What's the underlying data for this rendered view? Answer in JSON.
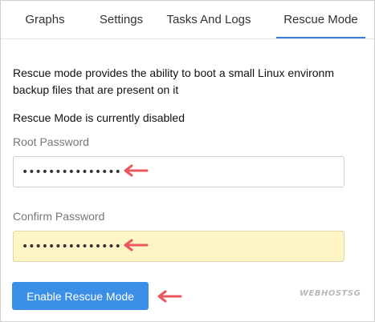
{
  "tabs": [
    {
      "label": "Graphs"
    },
    {
      "label": "Settings"
    },
    {
      "label": "Tasks And Logs"
    },
    {
      "label": "Rescue Mode",
      "active": true
    }
  ],
  "rescue": {
    "description_line1": "Rescue mode provides the ability to boot a small Linux environm",
    "description_line2": "backup files that are present on it",
    "status": "Rescue Mode is currently disabled",
    "root_password_label": "Root Password",
    "root_password_value": "•••••••••••••••",
    "confirm_password_label": "Confirm Password",
    "confirm_password_value": "•••••••••••••••",
    "button_label": "Enable Rescue Mode"
  },
  "watermark": "WEBHOSTSG",
  "colors": {
    "accent": "#3b7ddd",
    "button": "#3b8fe6",
    "arrow": "#e8585e",
    "autofill": "#fdf5c4"
  }
}
